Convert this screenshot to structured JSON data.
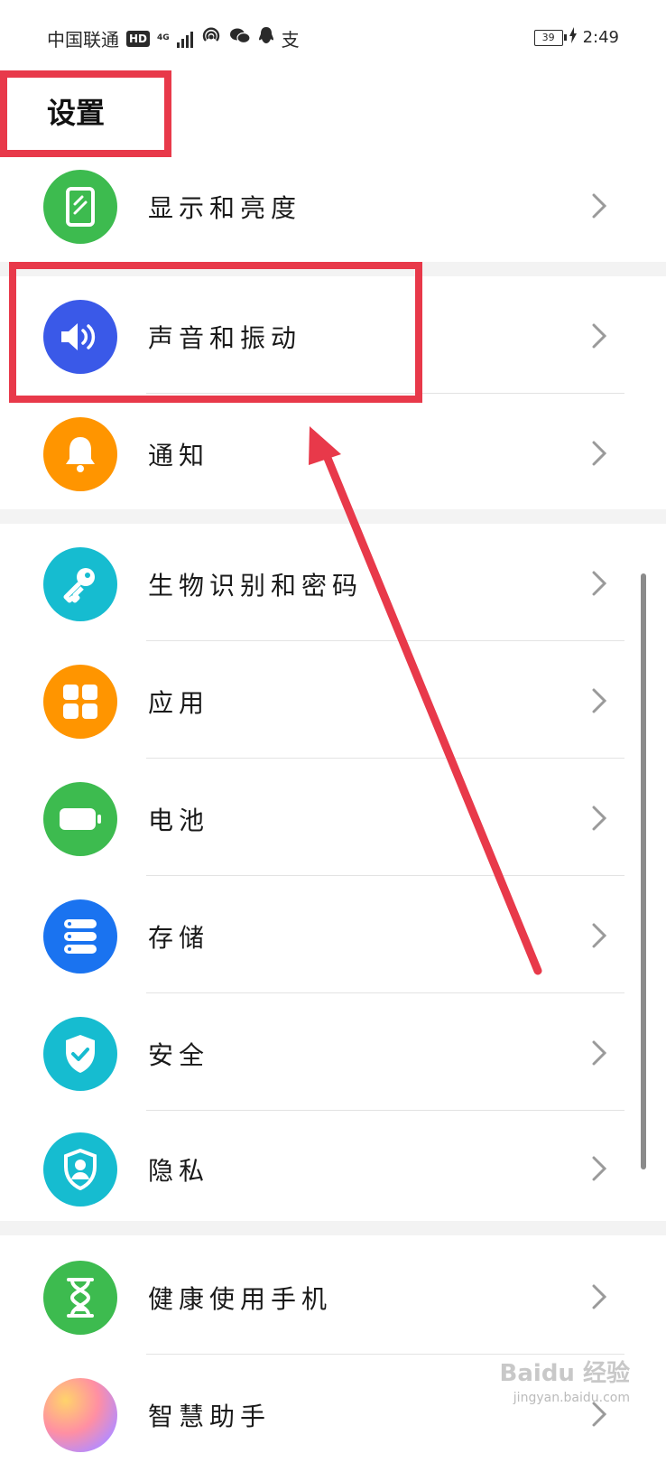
{
  "status_bar": {
    "carrier": "中国联通",
    "hd": "HD",
    "network": "4G",
    "battery_level": "39",
    "time": "2:49",
    "icons": [
      "hd-icon",
      "signal-icon",
      "hotspot-icon",
      "wechat-icon",
      "qq-icon",
      "alipay-icon",
      "battery-icon",
      "charging-icon"
    ]
  },
  "page_title": "设置",
  "sections": [
    {
      "items": [
        {
          "label": "显示和亮度",
          "icon": "display-icon",
          "color": "#3dbb4f"
        }
      ]
    },
    {
      "items": [
        {
          "label": "声音和振动",
          "icon": "sound-icon",
          "color": "#3a59e8"
        },
        {
          "label": "通知",
          "icon": "bell-icon",
          "color": "#ff9500"
        }
      ]
    },
    {
      "items": [
        {
          "label": "生物识别和密码",
          "icon": "key-icon",
          "color": "#16bcd0"
        },
        {
          "label": "应用",
          "icon": "apps-icon",
          "color": "#ff9500"
        },
        {
          "label": "电池",
          "icon": "battery-icon",
          "color": "#3dbb4f"
        },
        {
          "label": "存储",
          "icon": "storage-icon",
          "color": "#1a73f0"
        },
        {
          "label": "安全",
          "icon": "shield-check-icon",
          "color": "#16bcd0"
        },
        {
          "label": "隐私",
          "icon": "privacy-icon",
          "color": "#16bcd0"
        }
      ]
    },
    {
      "items": [
        {
          "label": "健康使用手机",
          "icon": "hourglass-icon",
          "color": "#3dbb4f"
        },
        {
          "label": "智慧助手",
          "icon": "assistant-icon",
          "color": "#c98bff"
        }
      ]
    }
  ],
  "annotation_color": "#e8394a",
  "watermark": {
    "brand": "Baidu 经验",
    "url": "jingyan.baidu.com"
  }
}
